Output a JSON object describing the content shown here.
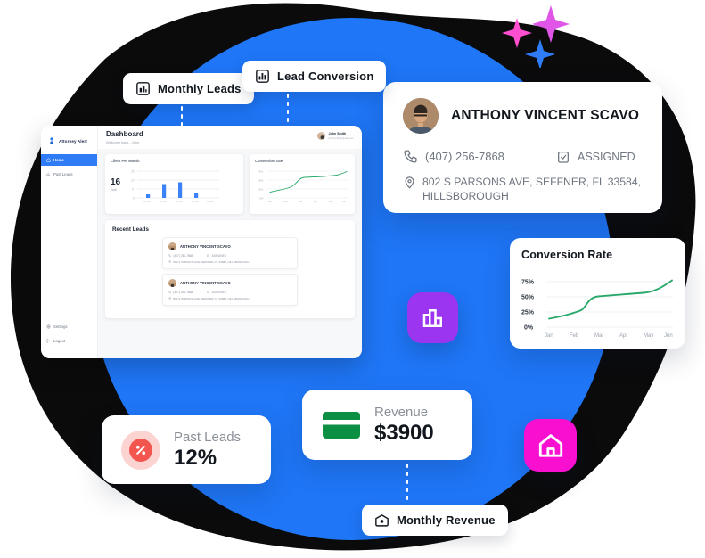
{
  "theme": {
    "blue": "#1f76f6",
    "dark_blob": "#0b0b0c",
    "green": "#2aa96a",
    "purple": "#9b35ef",
    "magenta": "#f80fd0",
    "red": "#f2564f",
    "pink_soft": "#fbd4d2"
  },
  "dashboard": {
    "brand": "Attorney Alert",
    "header": {
      "title": "Dashboard",
      "subtitle": "Welcome back , John",
      "user_name": "John Smith",
      "user_email": "johnsmith@gmail.com"
    },
    "sidebar": {
      "items": [
        {
          "label": "Home",
          "icon": "home-icon",
          "active": true
        },
        {
          "label": "Past Leads",
          "icon": "bar-chart-icon",
          "active": false
        }
      ],
      "bottom_items": [
        {
          "label": "Settings",
          "icon": "gear-icon"
        },
        {
          "label": "Logout",
          "icon": "logout-icon"
        }
      ]
    },
    "clients_card": {
      "title": "Client Per Month",
      "total_value": "16",
      "total_label": "Total"
    },
    "conversion_card": {
      "title": "Conversion rate"
    },
    "recent": {
      "title": "Recent Leads",
      "leads": [
        {
          "name": "ANTHONY VINCENT SCAVO",
          "phone": "(407) 256-7868",
          "status": "ASSIGNED",
          "address": "802 S PARSONS AVE, SEFFNER, FL 33584, HILLSBOROUGH"
        },
        {
          "name": "ANTHONY VINCENT SCAVO",
          "phone": "(407) 256-7868",
          "status": "ASSIGNED",
          "address": "802 S PARSONS AVE, SEFFNER, FL 33584, HILLSBOROUGH"
        }
      ]
    }
  },
  "contact_card": {
    "name": "ANTHONY VINCENT SCAVO",
    "phone": "(407) 256-7868",
    "status": "ASSIGNED",
    "address": "802 S PARSONS AVE, SEFFNER, FL 33584, HILLSBOROUGH"
  },
  "conversion_card": {
    "title": "Conversion Rate"
  },
  "stats": [
    {
      "label": "Past Leads",
      "value": "12%",
      "icon": "percent-icon"
    },
    {
      "label": "Revenue",
      "value": "$3900",
      "icon": "credit-card-icon"
    }
  ],
  "pills": [
    {
      "label": "Monthly Leads",
      "icon": "bar-chart-icon"
    },
    {
      "label": "Lead Conversion",
      "icon": "bar-chart-icon"
    },
    {
      "label": "Monthly Revenue",
      "icon": "money-icon"
    }
  ],
  "icon_squares": [
    {
      "name": "chart-icon",
      "color": "#9b35ef"
    },
    {
      "name": "home-icon",
      "color": "#f80fd0"
    }
  ],
  "chart_data": [
    {
      "type": "bar",
      "title": "Client Per Month",
      "categories": [
        "Jan",
        "Feb",
        "Mar",
        "Apr",
        "May"
      ],
      "values": [
        2,
        8,
        9,
        3,
        0
      ],
      "ylabel": "",
      "xlabel": "",
      "ylim": [
        0,
        15
      ],
      "yticks": [
        0,
        5,
        10,
        15
      ],
      "grid": true,
      "color": "#3b82f6"
    },
    {
      "type": "line",
      "title": "Conversion rate",
      "x": [
        "Jan",
        "Feb",
        "Mar",
        "Apr",
        "May",
        "Jun"
      ],
      "values": [
        18,
        30,
        52,
        58,
        62,
        78
      ],
      "ylim": [
        0,
        85
      ],
      "yticks": [
        0,
        25,
        50,
        75
      ],
      "ytick_labels": [
        "0%",
        "25%",
        "50%",
        "75%"
      ],
      "grid": true,
      "color": "#2aa96a"
    },
    {
      "type": "line",
      "title": "Conversion Rate",
      "x": [
        "Jan",
        "Feb",
        "Mar",
        "Apr",
        "May",
        "Jun"
      ],
      "values": [
        18,
        30,
        52,
        58,
        62,
        78
      ],
      "ylim": [
        0,
        85
      ],
      "yticks": [
        0,
        25,
        50,
        75
      ],
      "ytick_labels": [
        "0%",
        "25%",
        "50%",
        "75%"
      ],
      "xtick_labels": [
        "Jan",
        "Feb",
        "Mar",
        "Apr",
        "May",
        "Jun"
      ],
      "grid": true,
      "legend": "none",
      "color": "#2aa96a"
    }
  ]
}
